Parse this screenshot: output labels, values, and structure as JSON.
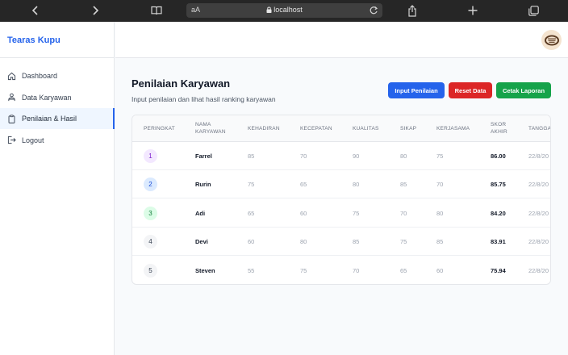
{
  "browser": {
    "text_size_label": "aA",
    "url": "localhost"
  },
  "sidebar": {
    "brand": "Tearas Kupu",
    "items": [
      {
        "label": "Dashboard"
      },
      {
        "label": "Data Karyawan"
      },
      {
        "label": "Penilaian & Hasil"
      },
      {
        "label": "Logout"
      }
    ]
  },
  "main": {
    "title": "Penilaian Karyawan",
    "subtitle": "Input penilaian dan lihat hasil ranking karyawan",
    "buttons": {
      "input": "Input Penilaian",
      "reset": "Reset Data",
      "print": "Cetak Laporan"
    },
    "table": {
      "headers": {
        "rank": "PERINGKAT",
        "name_1": "NAMA",
        "name_2": "KARYAWAN",
        "kehadiran": "KEHADIRAN",
        "kecepatan": "KECEPATAN",
        "kualitas": "KUALITAS",
        "sikap": "SIKAP",
        "kerjasama": "KERJASAMA",
        "skor_1": "SKOR",
        "skor_2": "AKHIR",
        "tanggal": "TANGGA"
      },
      "rows": [
        {
          "rank": "1",
          "name": "Farrel",
          "kehadiran": "85",
          "kecepatan": "70",
          "kualitas": "90",
          "sikap": "80",
          "kerjasama": "75",
          "skor": "86.00",
          "tanggal": "22/8/20"
        },
        {
          "rank": "2",
          "name": "Rurin",
          "kehadiran": "75",
          "kecepatan": "65",
          "kualitas": "80",
          "sikap": "85",
          "kerjasama": "70",
          "skor": "85.75",
          "tanggal": "22/8/20"
        },
        {
          "rank": "3",
          "name": "Adi",
          "kehadiran": "65",
          "kecepatan": "60",
          "kualitas": "75",
          "sikap": "70",
          "kerjasama": "80",
          "skor": "84.20",
          "tanggal": "22/8/20"
        },
        {
          "rank": "4",
          "name": "Devi",
          "kehadiran": "60",
          "kecepatan": "80",
          "kualitas": "85",
          "sikap": "75",
          "kerjasama": "85",
          "skor": "83.91",
          "tanggal": "22/8/20"
        },
        {
          "rank": "5",
          "name": "Steven",
          "kehadiran": "55",
          "kecepatan": "75",
          "kualitas": "70",
          "sikap": "65",
          "kerjasama": "60",
          "skor": "75.94",
          "tanggal": "22/8/20"
        }
      ]
    }
  },
  "colors": {
    "brand": "#2563eb",
    "rank_badges": [
      {
        "bg": "#f3e8ff",
        "fg": "#7e22ce"
      },
      {
        "bg": "#dbeafe",
        "fg": "#1d4ed8"
      },
      {
        "bg": "#dcfce7",
        "fg": "#15803d"
      },
      {
        "bg": "#f3f4f6",
        "fg": "#374151"
      },
      {
        "bg": "#f3f4f6",
        "fg": "#374151"
      }
    ]
  },
  "icons": [
    "back-icon",
    "forward-icon",
    "book-icon",
    "lock-icon",
    "reload-icon",
    "share-icon",
    "plus-icon",
    "tabs-icon",
    "home-icon",
    "users-icon",
    "clipboard-icon",
    "logout-icon"
  ]
}
